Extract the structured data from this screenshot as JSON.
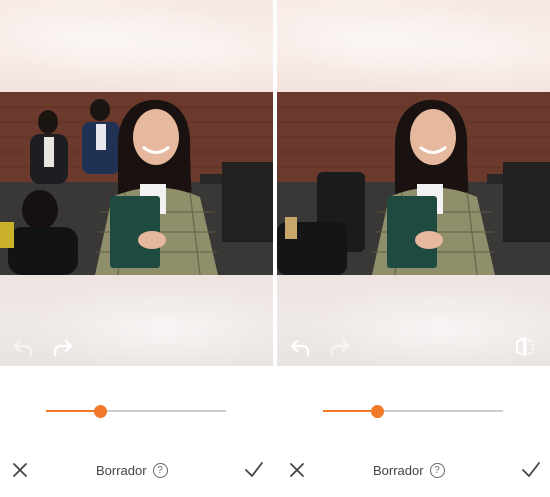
{
  "panels": [
    {
      "id": "left",
      "undo_enabled": false,
      "redo_enabled": true,
      "compare_visible": false,
      "slider_value": 0.29
    },
    {
      "id": "right",
      "undo_enabled": true,
      "redo_enabled": false,
      "compare_visible": true,
      "slider_value": 0.29
    }
  ],
  "bottom_bar": {
    "title": "Borrador",
    "help_glyph": "?"
  },
  "icons": {
    "close": "close-icon",
    "confirm": "checkmark-icon",
    "undo": "undo-arrow-icon",
    "redo": "redo-arrow-icon",
    "compare": "compare-split-icon",
    "help": "help-circle-icon"
  },
  "colors": {
    "accent": "#f07a2a",
    "track_inactive": "#cfcfcf",
    "icon_dark": "#444444",
    "canvas_bg": "#f1e7e4"
  }
}
